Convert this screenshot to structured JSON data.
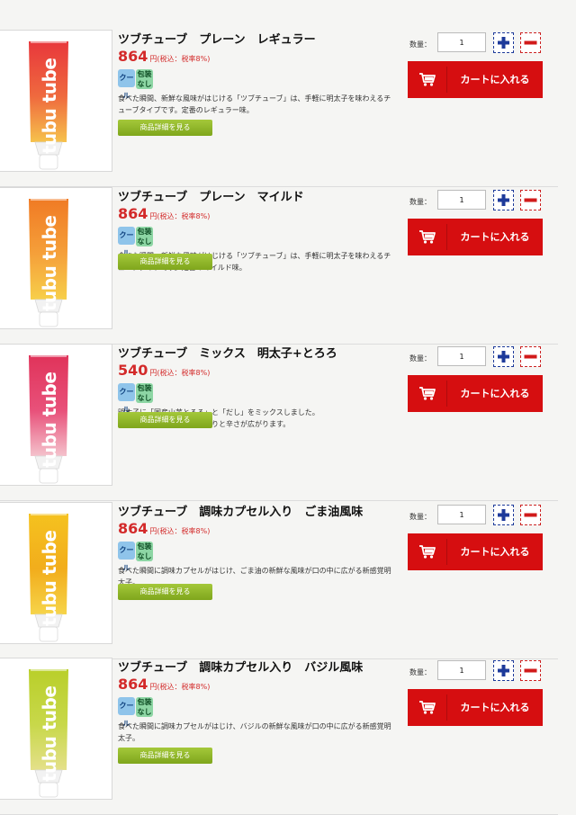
{
  "labels": {
    "quantity": "数量：",
    "cart": "カートに入れる",
    "detail": "商品詳細を見る",
    "tax": "円(税込：税率8%)",
    "badge_cool": "クール",
    "badge_nowrap": "包装\nなし"
  },
  "products": [
    {
      "title": "ツブチューブ　プレーン　レギュラー",
      "price": "864",
      "quantity": "1",
      "description": "食べた瞬間、新鮮な風味がはじける「ツブチューブ」は、手軽に明太子を味わえるチューブタイプです。定番のレギュラー味。",
      "tube_brand": "tubu tube",
      "colors": {
        "top": "#e8373c",
        "mid": "#ef6a3e",
        "bottom": "#f6c24c"
      }
    },
    {
      "title": "ツブチューブ　プレーン　マイルド",
      "price": "864",
      "quantity": "1",
      "description": "食べた瞬間、新鮮な風味がはじける「ツブチューブ」は、手軽に明太子を味わえるチューブタイプです。定番のマイルド味。",
      "tube_brand": "tubu tube",
      "colors": {
        "top": "#f07a24",
        "mid": "#f5a03a",
        "bottom": "#f7cf4a"
      }
    },
    {
      "title": "ツブチューブ　ミックス　明太子+とろろ",
      "price": "540",
      "quantity": "1",
      "description": "明太子に「国産山芋とろろ」と「だし」をミックスしました。\n新鮮なとろろの風味にほんのりと辛さが広がります。",
      "tube_brand": "tubu tube",
      "colors": {
        "top": "#e0335a",
        "mid": "#e8517a",
        "bottom": "#f4c2cc"
      }
    },
    {
      "title": "ツブチューブ　調味カプセル入り　ごま油風味",
      "price": "864",
      "quantity": "1",
      "description": "食べた瞬間に調味カプセルがはじけ、ごま油の新鮮な風味が口の中に広がる新感覚明太子。",
      "tube_brand": "tubu tube",
      "colors": {
        "top": "#f5c21f",
        "mid": "#f2ad1c",
        "bottom": "#f6d44a"
      }
    },
    {
      "title": "ツブチューブ　調味カプセル入り　バジル風味",
      "price": "864",
      "quantity": "1",
      "description": "食べた瞬間に調味カプセルがはじけ、バジルの新鮮な風味が口の中に広がる新感覚明太子。",
      "tube_brand": "tubu tube",
      "colors": {
        "top": "#b9cf2a",
        "mid": "#c8d84a",
        "bottom": "#e4e08a"
      }
    }
  ]
}
